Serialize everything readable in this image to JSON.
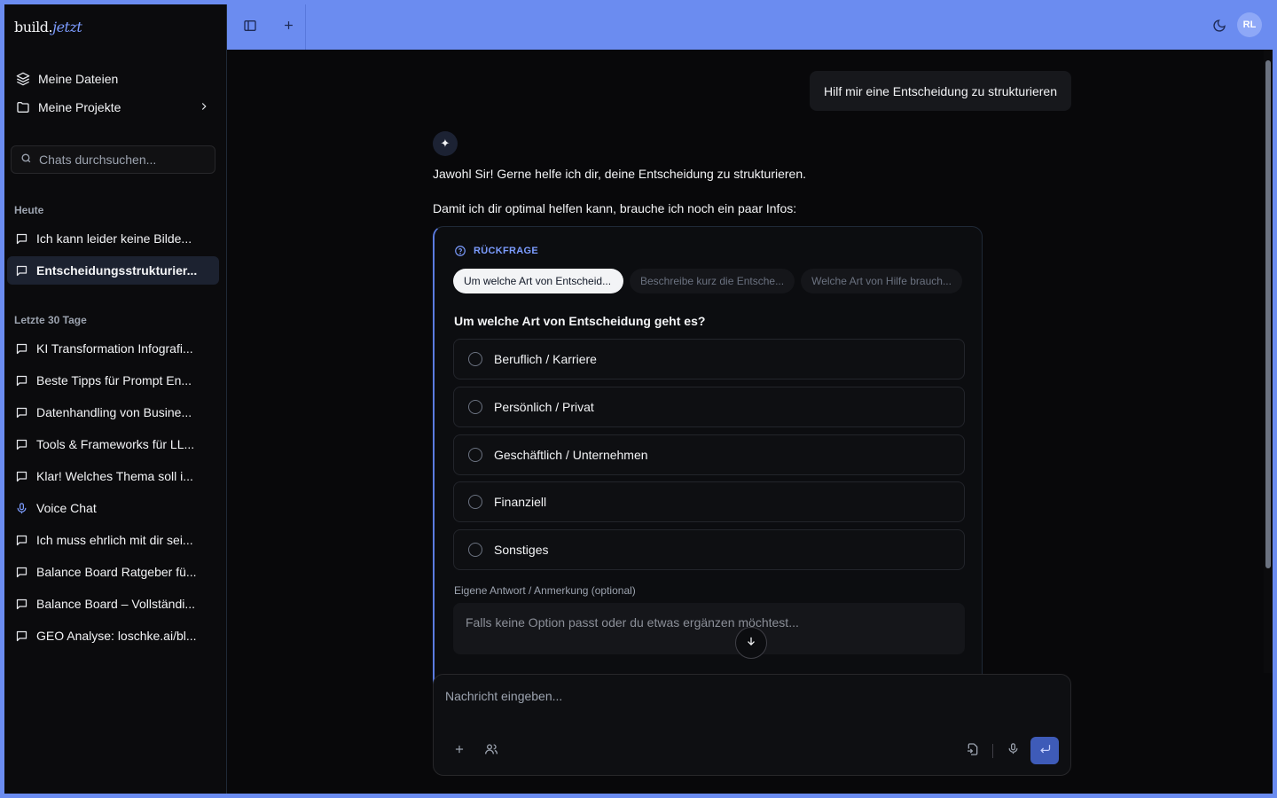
{
  "brand": {
    "name": "build",
    "accent": "jetzt"
  },
  "nav": {
    "files": "Meine Dateien",
    "projects": "Meine Projekte"
  },
  "search": {
    "placeholder": "Chats durchsuchen..."
  },
  "sections": {
    "today": "Heute",
    "last30": "Letzte 30 Tage"
  },
  "chats_today": [
    {
      "label": "Ich kann leider keine Bilde...",
      "icon": "chat-bubble-icon"
    },
    {
      "label": "Entscheidungsstrukturier...",
      "icon": "chat-bubble-icon",
      "active": true
    }
  ],
  "chats_last30": [
    {
      "label": "KI Transformation Infografi...",
      "icon": "chat-bubble-icon"
    },
    {
      "label": "Beste Tipps für Prompt En...",
      "icon": "chat-bubble-icon"
    },
    {
      "label": "Datenhandling von Busine...",
      "icon": "chat-bubble-icon"
    },
    {
      "label": "Tools & Frameworks für LL...",
      "icon": "chat-bubble-icon"
    },
    {
      "label": "Klar! Welches Thema soll i...",
      "icon": "chat-bubble-icon"
    },
    {
      "label": "Voice Chat",
      "icon": "microphone-icon"
    },
    {
      "label": "Ich muss ehrlich mit dir sei...",
      "icon": "chat-bubble-icon"
    },
    {
      "label": "Balance Board Ratgeber fü...",
      "icon": "chat-bubble-icon"
    },
    {
      "label": "Balance Board – Vollständi...",
      "icon": "chat-bubble-icon"
    },
    {
      "label": "GEO Analyse: loschke.ai/bl...",
      "icon": "chat-bubble-icon"
    }
  ],
  "user": {
    "initials": "RL"
  },
  "conversation": {
    "user_message": "Hilf mir eine Entscheidung zu strukturieren",
    "ai_intro": "Jawohl Sir! Gerne helfe ich dir, deine Entscheidung zu strukturieren.",
    "ai_followup": "Damit ich dir optimal helfen kann, brauche ich noch ein paar Infos:"
  },
  "question_card": {
    "label": "RÜCKFRAGE",
    "tabs": [
      "Um welche Art von Entscheid...",
      "Beschreibe kurz die Entsche...",
      "Welche Art von Hilfe brauch..."
    ],
    "question": "Um welche Art von Entscheidung geht es?",
    "options": [
      "Beruflich / Karriere",
      "Persönlich / Privat",
      "Geschäftlich / Unternehmen",
      "Finanziell",
      "Sonstiges"
    ],
    "own_answer_label": "Eigene Antwort / Anmerkung (optional)",
    "own_answer_placeholder": "Falls keine Option passt oder du etwas ergänzen möchtest..."
  },
  "composer": {
    "placeholder": "Nachricht eingeben..."
  },
  "colors": {
    "accent": "#6b8cf0",
    "send": "#3e5bb8",
    "background": "#08080a"
  }
}
